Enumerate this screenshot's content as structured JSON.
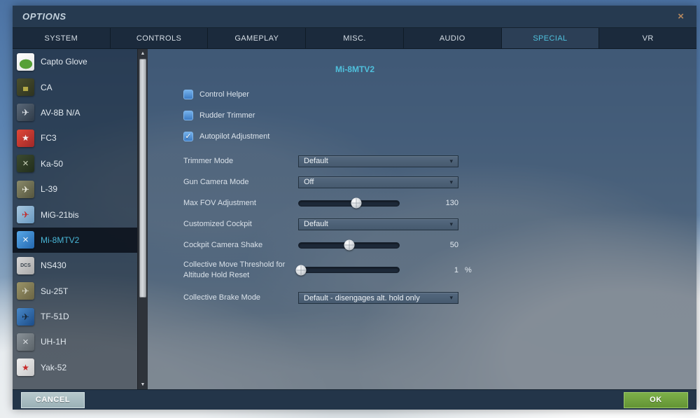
{
  "window": {
    "title": "OPTIONS"
  },
  "icons": {
    "close": "×",
    "chevron_down": "▾",
    "check": "✓",
    "arrow_up": "▲",
    "arrow_down": "▼"
  },
  "tabs": [
    {
      "label": "SYSTEM",
      "active": false
    },
    {
      "label": "CONTROLS",
      "active": false
    },
    {
      "label": "GAMEPLAY",
      "active": false
    },
    {
      "label": "MISC.",
      "active": false
    },
    {
      "label": "AUDIO",
      "active": false
    },
    {
      "label": "SPECIAL",
      "active": true
    },
    {
      "label": "VR",
      "active": false
    }
  ],
  "sidebar": {
    "selected": "Mi-8MTV2",
    "items": [
      {
        "label": "Capto Glove",
        "icon": "capto-glove-icon",
        "glyph": "",
        "icon_style": "background:radial-gradient(62% 46% at 52% 62%, #57a037 0 58%, rgba(0,0,0,0) 60%), linear-gradient(150deg,#ffffff,#e4e4e4)",
        "glyph_style": ""
      },
      {
        "label": "CA",
        "icon": "combined-arms-icon",
        "glyph": "▄",
        "icon_style": "background:linear-gradient(135deg,#4a4f2e,#2e3320)",
        "glyph_style": "color:#b2a847;font-size:10px"
      },
      {
        "label": "AV-8B N/A",
        "icon": "av8b-icon",
        "glyph": "✈",
        "icon_style": "background:linear-gradient(135deg,#5a6878,#2f3b48)",
        "glyph_style": "color:#d8dde2"
      },
      {
        "label": "FC3",
        "icon": "fc3-icon",
        "glyph": "★",
        "icon_style": "background:linear-gradient(135deg,#e04838,#a02828)",
        "glyph_style": "color:#f5f5f5;font-size:12px"
      },
      {
        "label": "Ka-50",
        "icon": "ka50-icon",
        "glyph": "×",
        "icon_style": "background:linear-gradient(135deg,#3c4a30,#222e1c)",
        "glyph_style": "color:#c8d0b8;font-size:15px"
      },
      {
        "label": "L-39",
        "icon": "l39-icon",
        "glyph": "✈",
        "icon_style": "background:linear-gradient(135deg,#8a8a6a,#55553e)",
        "glyph_style": "color:#e8e8d8"
      },
      {
        "label": "MiG-21bis",
        "icon": "mig21-icon",
        "glyph": "✈",
        "icon_style": "background:linear-gradient(135deg,#a8c8e0,#6898c0)",
        "glyph_style": "color:#c03030"
      },
      {
        "label": "Mi-8MTV2",
        "icon": "mi8-icon",
        "glyph": "×",
        "icon_style": "background:linear-gradient(135deg,#58a8e8,#2468b0)",
        "glyph_style": "color:#f0f4f8;font-size:15px"
      },
      {
        "label": "NS430",
        "icon": "ns430-icon",
        "glyph": "DCS",
        "icon_style": "background:linear-gradient(135deg,#d8d8d8,#a8a8a8)",
        "glyph_style": "color:#3c4650;font-size:7px;font-weight:bold"
      },
      {
        "label": "Su-25T",
        "icon": "su25t-icon",
        "glyph": "✈",
        "icon_style": "background:linear-gradient(135deg,#9a9468,#6a6444)",
        "glyph_style": "color:#d0d0c0"
      },
      {
        "label": "TF-51D",
        "icon": "tf51d-icon",
        "glyph": "✈",
        "icon_style": "background:linear-gradient(135deg,#4888c8,#1c4c88)",
        "glyph_style": "color:#182838"
      },
      {
        "label": "UH-1H",
        "icon": "uh1h-icon",
        "glyph": "×",
        "icon_style": "background:linear-gradient(135deg,#8a9298,#5a6268)",
        "glyph_style": "color:#d8dce0;font-size:15px"
      },
      {
        "label": "Yak-52",
        "icon": "yak52-icon",
        "glyph": "★",
        "icon_style": "background:linear-gradient(135deg,#f0f0f0,#c8c8c8)",
        "glyph_style": "color:#c82828;font-size:12px"
      }
    ]
  },
  "main": {
    "title": "Mi-8MTV2",
    "checkboxes": [
      {
        "label": "Control Helper",
        "checked": false,
        "check_glyph": ""
      },
      {
        "label": "Rudder Trimmer",
        "checked": false,
        "check_glyph": ""
      },
      {
        "label": "Autopilot Adjustment",
        "checked": true,
        "check_glyph": "✓"
      }
    ],
    "settings": [
      {
        "label": "Trimmer Mode",
        "type": "dropdown",
        "value": "Default"
      },
      {
        "label": "Gun Camera Mode",
        "type": "dropdown",
        "value": "Off"
      },
      {
        "label": "Max FOV Adjustment",
        "type": "slider",
        "value": "130",
        "unit": "",
        "thumb_style": "left:57%"
      },
      {
        "label": "Customized Cockpit",
        "type": "dropdown",
        "value": "Default"
      },
      {
        "label": "Cockpit Camera Shake",
        "type": "slider",
        "value": "50",
        "unit": "",
        "thumb_style": "left:50%"
      },
      {
        "label": "Collective Move Threshold for Altitude Hold Reset",
        "type": "slider",
        "value": "1",
        "unit": "%",
        "thumb_style": "left:3%"
      },
      {
        "label": "Collective Brake Mode",
        "type": "dropdown",
        "value": "Default - disengages alt. hold only"
      }
    ]
  },
  "footer": {
    "cancel": "CANCEL",
    "ok": "OK"
  },
  "colors": {
    "accent_cyan": "#4fc0dc",
    "panel_navy": "#263a50",
    "checkbox_blue": "#4a8fd4",
    "ok_green": "#6ba33f",
    "cancel_gray": "#a9bdc2",
    "close_tan": "#b5885e"
  }
}
